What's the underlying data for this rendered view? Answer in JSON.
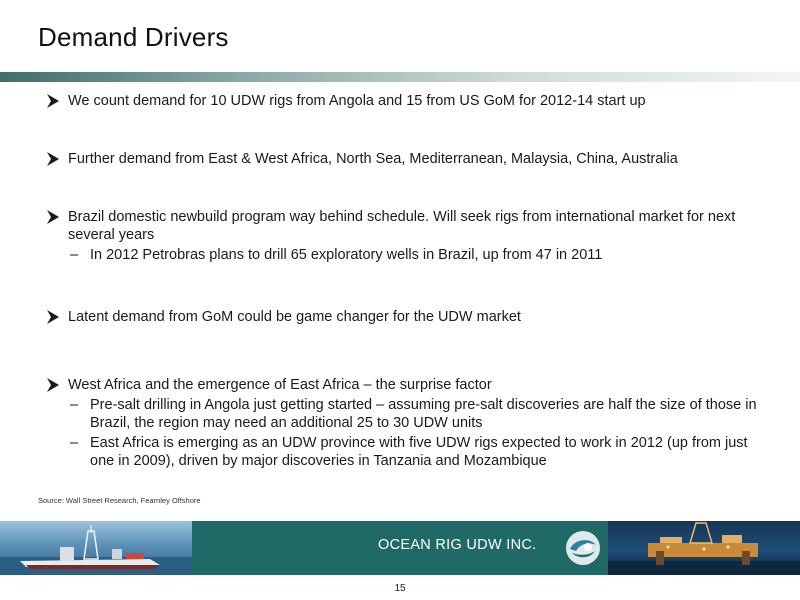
{
  "title": "Demand Drivers",
  "bullets": [
    {
      "text": "We count demand for 10 UDW rigs from Angola and 15 from US GoM for 2012-14 start up",
      "subs": []
    },
    {
      "text": "Further demand from East & West Africa, North Sea, Mediterranean, Malaysia, China, Australia",
      "subs": []
    },
    {
      "text": "Brazil domestic newbuild program way behind schedule. Will seek rigs from international market for next several years",
      "subs": [
        "In 2012 Petrobras plans to drill 65 exploratory wells in Brazil, up from 47 in 2011"
      ]
    },
    {
      "text": "Latent demand from GoM could be game changer for the UDW market",
      "subs": []
    },
    {
      "text": "West Africa and the emergence of East Africa – the surprise factor",
      "subs": [
        "Pre-salt drilling in Angola just getting started – assuming pre-salt discoveries are half the size of those in Brazil, the region may need an additional 25 to 30 UDW units",
        "East Africa is emerging as an UDW province with five UDW rigs expected to work in 2012 (up from just one in 2009), driven by major discoveries in Tanzania and Mozambique"
      ]
    }
  ],
  "source": "Source: Wall Street Research, Fearnley Offshore",
  "footer": {
    "company": "OCEAN RIG UDW INC."
  },
  "page_number": "15",
  "colors": {
    "footer_teal": "#1f6a66",
    "arrow": "#1a1a1a"
  }
}
